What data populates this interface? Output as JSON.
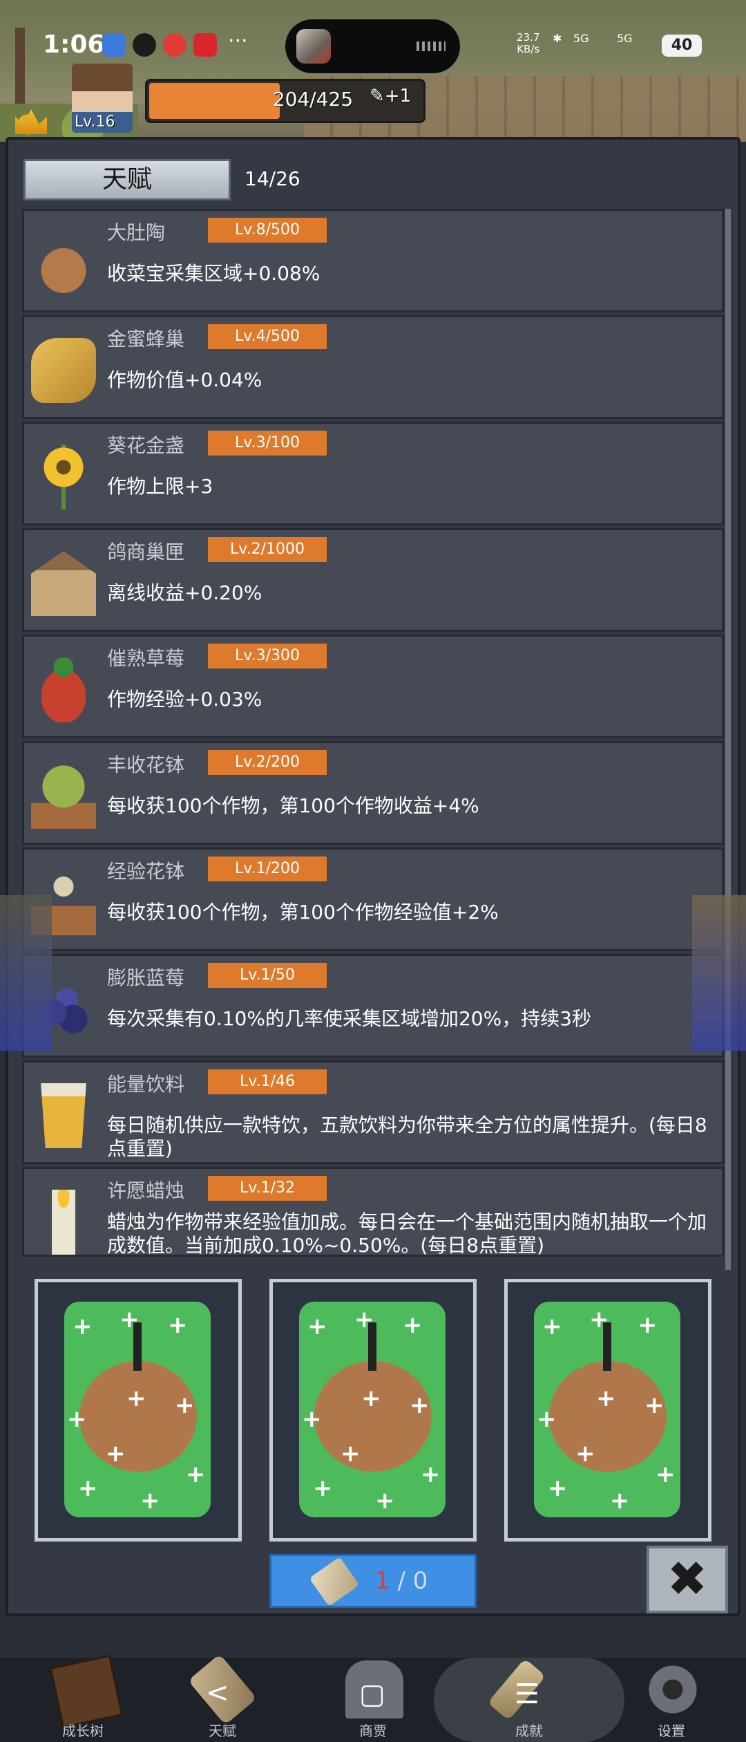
{
  "status_bar": {
    "time": "1:06",
    "net_speed_value": "23.7",
    "net_speed_unit": "KB/s",
    "signal_1": "5G",
    "signal_2": "5G",
    "battery": "40",
    "more": "···"
  },
  "player": {
    "level": "Lv.16",
    "xp_text": "204/425",
    "xp_fraction": 0.48,
    "scroll_bonus": "+1"
  },
  "panel": {
    "tab_label": "天赋",
    "count": "14/26",
    "talents": [
      {
        "name": "大肚陶",
        "level": "Lv.8/500",
        "desc": "收菜宝采集区域+0.08%",
        "icon": "clay-jug-icon"
      },
      {
        "name": "金蜜蜂巢",
        "level": "Lv.4/500",
        "desc": "作物价值+0.04%",
        "icon": "honeycomb-icon"
      },
      {
        "name": "葵花金盏",
        "level": "Lv.3/100",
        "desc": "作物上限+3",
        "icon": "sunflower-icon"
      },
      {
        "name": "鸽商巢匣",
        "level": "Lv.2/1000",
        "desc": "离线收益+0.20%",
        "icon": "birdhouse-icon"
      },
      {
        "name": "催熟草莓",
        "level": "Lv.3/300",
        "desc": "作物经验+0.03%",
        "icon": "strawberry-icon"
      },
      {
        "name": "丰收花钵",
        "level": "Lv.2/200",
        "desc": "每收获100个作物，第100个作物收益+4%",
        "icon": "flower-pot-icon"
      },
      {
        "name": "经验花钵",
        "level": "Lv.1/200",
        "desc": "每收获100个作物，第100个作物经验值+2%",
        "icon": "sprout-pot-icon"
      },
      {
        "name": "膨胀蓝莓",
        "level": "Lv.1/50",
        "desc": "每次采集有0.10%的几率使采集区域增加20%，持续3秒",
        "icon": "blueberry-icon"
      },
      {
        "name": "能量饮料",
        "level": "Lv.1/46",
        "desc": "每日随机供应一款特饮，五款饮料为你带来全方位的属性提升。(每日8点重置)",
        "icon": "drink-cup-icon"
      },
      {
        "name": "许愿蜡烛",
        "level": "Lv.1/32",
        "desc": "蜡烛为作物带来经验值加成。每日会在一个基础范围内随机抽取一个加成数值。当前加成0.10%~0.50%。(每日8点重置)",
        "icon": "candle-icon"
      }
    ]
  },
  "cards": [
    {
      "icon": "fruit-card-icon"
    },
    {
      "icon": "fruit-card-icon"
    },
    {
      "icon": "fruit-card-icon"
    }
  ],
  "draw_button": {
    "current": "1",
    "separator": " / ",
    "max": "0"
  },
  "close_button": {
    "label": "✖"
  },
  "bottom_nav": [
    {
      "label": "成长树",
      "icon": "book-icon"
    },
    {
      "label": "天赋",
      "icon": "scroll-icon"
    },
    {
      "label": "商贾",
      "icon": "shop-icon"
    },
    {
      "label": "成就",
      "icon": "key-icon"
    },
    {
      "label": "设置",
      "icon": "gear-icon"
    }
  ],
  "system_nav": {
    "back": "<",
    "home": "▢",
    "menu": "☰"
  },
  "colors": {
    "panel_bg": "#343943",
    "row_bg": "#454a55",
    "level_badge": "#df7a2c",
    "xp_bar": "#e88433",
    "draw_button": "#3f8fe5",
    "card_green": "#4dbb5b"
  }
}
